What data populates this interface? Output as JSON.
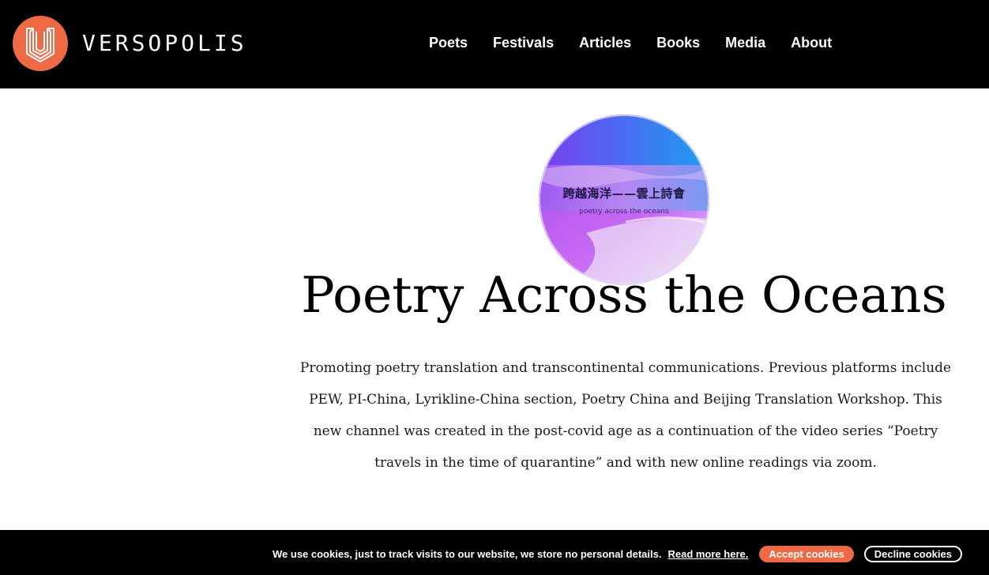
{
  "brand": {
    "name": "VERSOPOLIS",
    "accent_color": "#ee6a45",
    "logo_icon": "versopolis-logo-icon"
  },
  "nav": {
    "items": [
      {
        "label": "Poets"
      },
      {
        "label": "Festivals"
      },
      {
        "label": "Articles"
      },
      {
        "label": "Books"
      },
      {
        "label": "Media"
      },
      {
        "label": "About"
      }
    ]
  },
  "hero": {
    "image_text_cn": "跨越海洋——雲上詩會",
    "image_text_en": "poetry across the oceans",
    "title": "Poetry Across the Oceans",
    "description": "Promoting poetry translation and transcontinental communications. Previous platforms include PEW, PI-China, Lyrikline-China section, Poetry China and Beijing Translation Workshop. This new channel was created in the post-covid age as a continuation of the video series “Poetry travels in the time of quarantine” and with new online readings via zoom."
  },
  "cookie": {
    "message": "We use cookies, just to track visits to our website, we store no personal details.",
    "read_more": "Read more here.",
    "accept_label": "Accept cookies",
    "decline_label": "Decline cookies"
  }
}
